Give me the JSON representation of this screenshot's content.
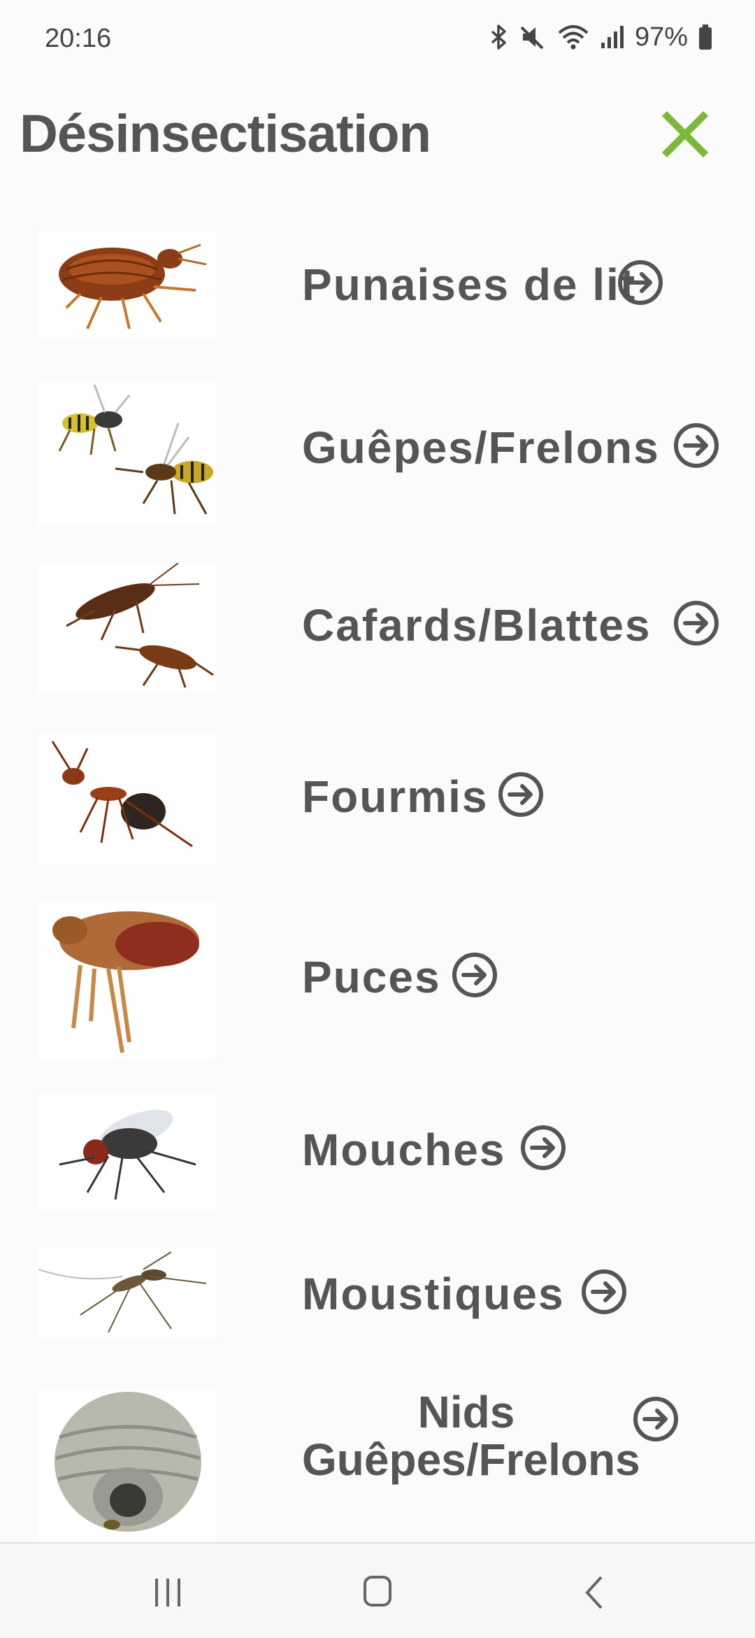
{
  "status_bar": {
    "time": "20:16",
    "battery": "97%",
    "icons": [
      "bluetooth-icon",
      "mute-icon",
      "wifi-icon",
      "signal-icon",
      "battery-icon"
    ]
  },
  "header": {
    "title": "Désinsectisation",
    "close_icon": "close-icon",
    "accent_color": "#7cb83c"
  },
  "items": [
    {
      "label": "Punaises de lit",
      "icon": "arrow-circle-right-icon",
      "image": "bed-bug-image"
    },
    {
      "label": "Guêpes/Frelons",
      "icon": "arrow-circle-right-icon",
      "image": "wasps-image"
    },
    {
      "label": "Cafards/Blattes",
      "icon": "arrow-circle-right-icon",
      "image": "cockroaches-image"
    },
    {
      "label": "Fourmis",
      "icon": "arrow-circle-right-icon",
      "image": "ant-image"
    },
    {
      "label": "Puces",
      "icon": "arrow-circle-right-icon",
      "image": "flea-image"
    },
    {
      "label": "Mouches",
      "icon": "arrow-circle-right-icon",
      "image": "fly-image"
    },
    {
      "label": "Moustiques",
      "icon": "arrow-circle-right-icon",
      "image": "mosquito-image"
    },
    {
      "label_line1": "Nids",
      "label_line2": "Guêpes/Frelons",
      "icon": "arrow-circle-right-icon",
      "image": "wasp-nest-image"
    }
  ],
  "nav_bar": {
    "buttons": [
      "recent-apps-icon",
      "home-icon",
      "back-icon"
    ]
  }
}
